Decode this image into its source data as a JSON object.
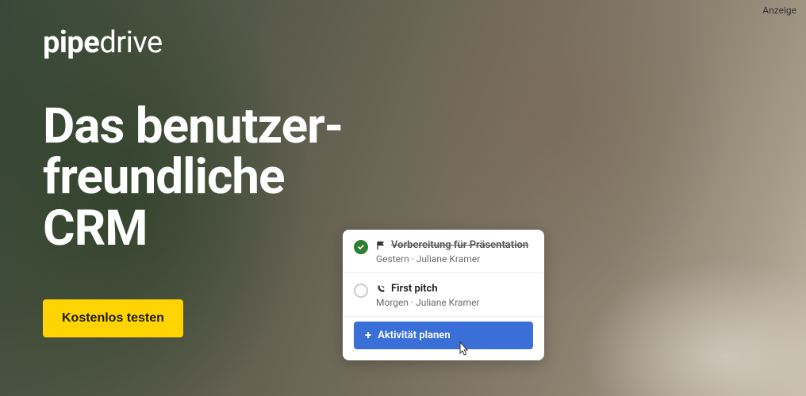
{
  "ad_label": "Anzeige",
  "logo": {
    "part1": "pipe",
    "part2": "drive"
  },
  "headline": "Das benutzer-\nfreundliche\nCRM",
  "cta_label": "Kostenlos testen",
  "card": {
    "tasks": [
      {
        "status": "done",
        "icon": "flag",
        "title": "Vorbereitung für Präsentation",
        "sub": "Gestern · Juliane Kramer"
      },
      {
        "status": "open",
        "icon": "phone",
        "title": "First pitch",
        "sub": "Morgen · Juliane Kramer"
      }
    ],
    "action_label": "Aktivität planen"
  }
}
